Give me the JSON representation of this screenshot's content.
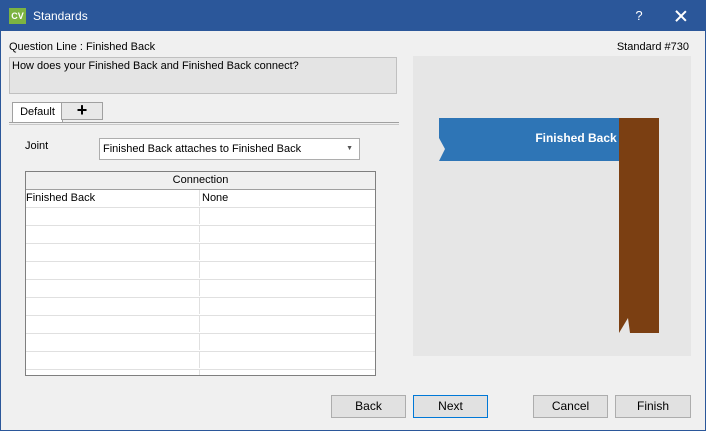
{
  "window": {
    "title": "Standards",
    "app_icon": "CV",
    "help_glyph": "?"
  },
  "header": {
    "question_line": "Question Line : Finished Back",
    "standard_number": "Standard #730"
  },
  "question": {
    "text": "How does your Finished Back and Finished Back connect?"
  },
  "tabs": {
    "default_label": "Default",
    "add_glyph": "+"
  },
  "joint": {
    "label": "Joint",
    "value": "Finished Back attaches to Finished Back"
  },
  "grid": {
    "header": "Connection",
    "rows": [
      {
        "name": "Finished Back",
        "value": "None"
      }
    ]
  },
  "preview": {
    "banner_label": "Finished Back",
    "banner_color": "#2e75b6",
    "board_color": "#7b3f12"
  },
  "buttons": {
    "back": "Back",
    "next": "Next",
    "cancel": "Cancel",
    "finish": "Finish"
  },
  "colors": {
    "titlebar": "#2b579a",
    "accent": "#0078d7",
    "app_icon": "#7cb342"
  }
}
